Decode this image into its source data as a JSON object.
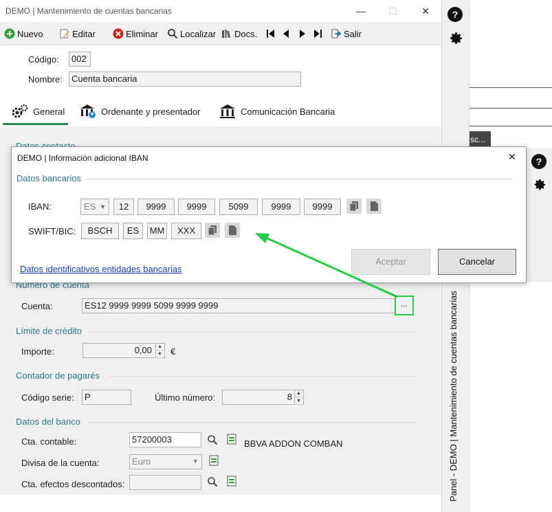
{
  "main": {
    "title": "DEMO | Mantenimiento de cuentas bancarias",
    "toolbar": {
      "nuevo": "Nuevo",
      "editar": "Editar",
      "eliminar": "Eliminar",
      "localizar": "Localizar",
      "docs": "Docs.",
      "salir": "Salir"
    },
    "codigo_label": "Código:",
    "codigo_value": "002",
    "nombre_label": "Nombre:",
    "nombre_value": "Cuenta bancaria",
    "tabs": [
      "General",
      "Ordenante y presentador",
      "Comunicación Bancaria"
    ],
    "sections": {
      "datos_contacto": "Datos contacto",
      "numero_cuenta": "Número de cuenta",
      "limite_credito": "Límite de crédito",
      "contador_pagares": "Contador de pagarés",
      "datos_banco": "Datos del banco"
    },
    "cuenta_label": "Cuenta:",
    "cuenta_value": "ES12 9999 9999 5099 9999 9999",
    "cuenta_button": "...",
    "importe_label": "Importe:",
    "importe_value": "0,00",
    "currency": "€",
    "codigo_serie_label": "Código serie:",
    "codigo_serie_value": "P",
    "ultimo_numero_label": "Último número:",
    "ultimo_numero_value": "8",
    "cta_contable_label": "Cta. contable:",
    "cta_contable_value": "57200003",
    "bank_name": "BBVA ADDON COMBAN",
    "divisa_label": "Divisa de la cuenta:",
    "divisa_value": "Euro",
    "cta_efectos_label": "Cta. efectos descontados:",
    "cta_efectos_value": ""
  },
  "side_panel": {
    "vertical_title": "Panel - DEMO | Mantenimiento de cuentas bancarias",
    "help": "?"
  },
  "background": {
    "partial_text": "sc..."
  },
  "dialog": {
    "title": "DEMO | Información adicional IBAN",
    "section": "Datos bancarios",
    "iban_label": "IBAN:",
    "iban_country": "ES",
    "iban_parts": [
      "12",
      "9999",
      "9999",
      "5099",
      "9999",
      "9999"
    ],
    "swift_label": "SWIFT/BIC:",
    "swift_parts": [
      "BSCH",
      "ES",
      "MM",
      "XXX"
    ],
    "link": "Datos identificativos entidades bancarias",
    "accept": "Aceptar",
    "cancel": "Cancelar",
    "close": "✕"
  },
  "colors": {
    "accent_green": "#22cc44",
    "section_teal": "#2a7a8c",
    "tab_underline": "#2e8b57",
    "link_blue": "#1a3fbf"
  }
}
